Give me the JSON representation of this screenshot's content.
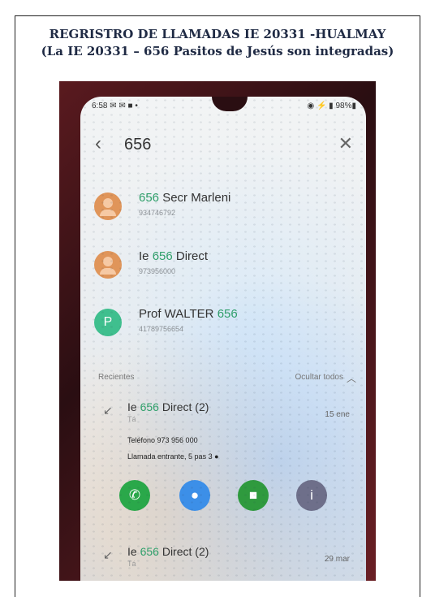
{
  "document": {
    "title_line1": "REGRISTRO DE LLAMADAS IE 20331 -HUALMAY",
    "title_line2": "(La IE 20331 – 656 Pasitos de Jesús son integradas)"
  },
  "phone": {
    "status_time": "6:58 ✉ ✉ ■ •",
    "status_right": "◉ ⚡ ▮ 98%▮",
    "search": {
      "back_icon": "‹",
      "query": "656",
      "close_icon": "✕"
    },
    "contacts": [
      {
        "highlight": "656",
        "name_rest": " Secr Marleni",
        "number": "934746792",
        "avatar": "person",
        "color": "orange"
      },
      {
        "prefix": "Ie ",
        "highlight": "656",
        "name_rest": " Direct",
        "number": "973956000",
        "avatar": "person",
        "color": "orange"
      },
      {
        "prefix": "Prof WALTER ",
        "highlight": "656",
        "name_rest": "",
        "number": "41789756654",
        "avatar": "P",
        "color": "green"
      }
    ],
    "recents": {
      "label": "Recientes",
      "hide_label": "Ocultar todos",
      "items": [
        {
          "prefix": "Ie ",
          "highlight": "656",
          "name_rest": " Direct (2)",
          "sub": "Tá",
          "time": "15 ene"
        },
        {
          "prefix": "Ie ",
          "highlight": "656",
          "name_rest": " Direct (2)",
          "sub": "Tá",
          "time": "29 mar"
        }
      ],
      "detail_phone": "Teléfono 973 956 000",
      "detail_call": "Llamada entrante, 5 pas 3 ●"
    },
    "actions": {
      "call_icon": "✆",
      "message_icon": "●",
      "video_icon": "■",
      "info_icon": "i"
    }
  }
}
